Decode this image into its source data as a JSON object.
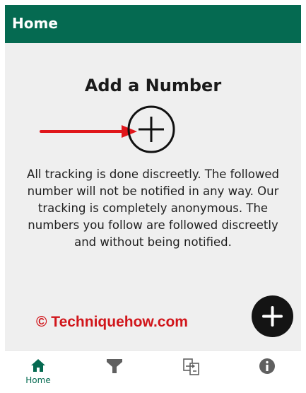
{
  "appbar": {
    "title": "Home"
  },
  "main": {
    "heading": "Add a Number",
    "add_icon": "plus-circle-icon",
    "annotation_arrow": "red-arrow",
    "description": "All tracking is done discreetly. The followed number will not be notified in any way. Our tracking is completely anonymous. The numbers you follow are followed discreetly and without being notified."
  },
  "watermark": "© Techniquehow.com",
  "fab": {
    "icon": "plus-icon"
  },
  "bottom_nav": {
    "items": [
      {
        "icon": "home-icon",
        "label": "Home",
        "active": true
      },
      {
        "icon": "filter-icon",
        "label": ""
      },
      {
        "icon": "compare-icon",
        "label": ""
      },
      {
        "icon": "info-icon",
        "label": ""
      }
    ]
  },
  "colors": {
    "primary": "#056a51",
    "background": "#efefef",
    "fab": "#141414",
    "annotation": "#e0161b",
    "inactive_icon": "#606060"
  }
}
